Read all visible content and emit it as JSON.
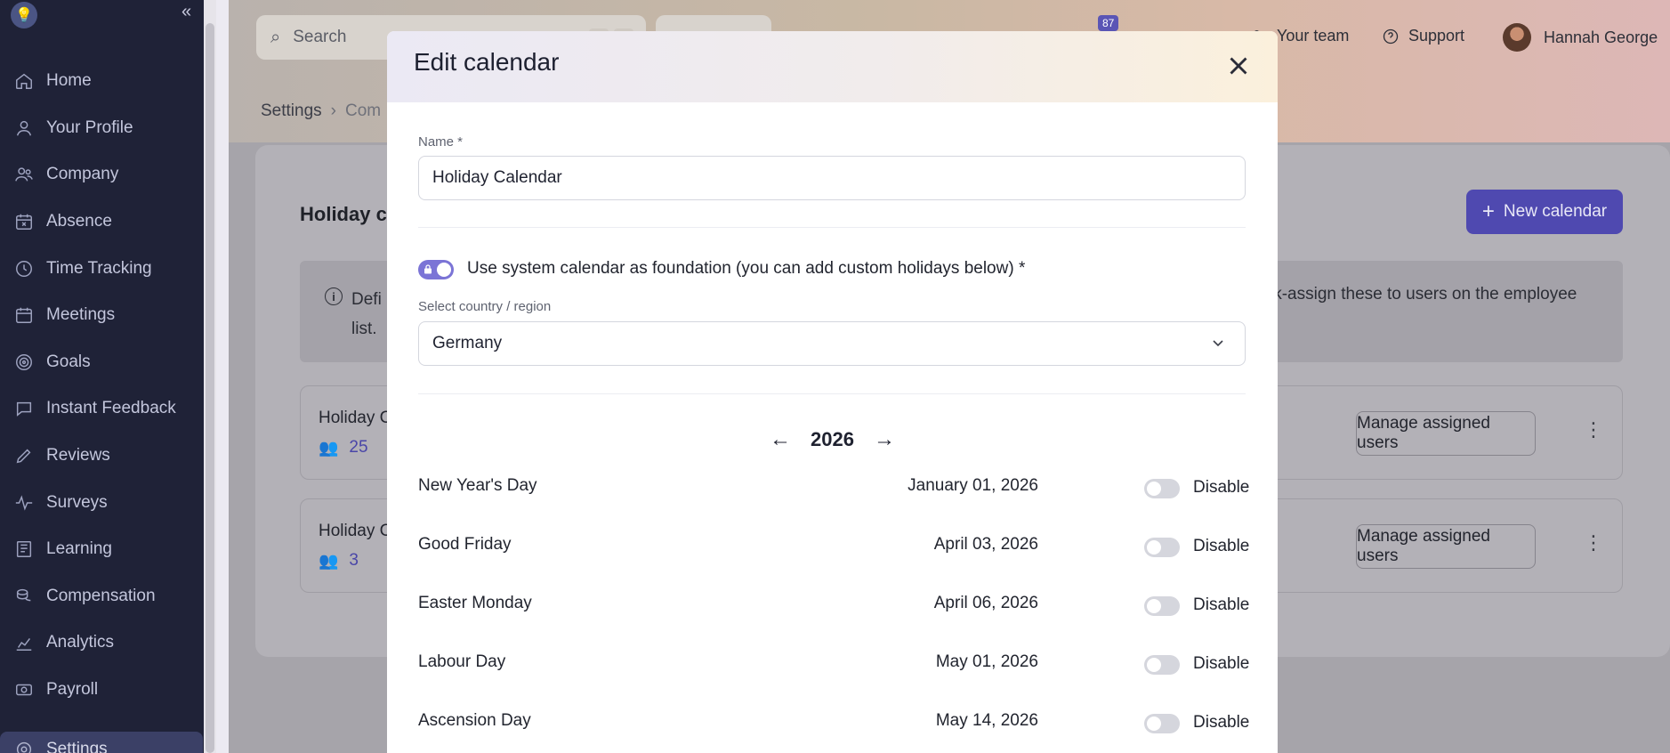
{
  "sidebar": {
    "collapse_glyph": "«",
    "items": [
      {
        "label": "Home",
        "icon": "home-icon"
      },
      {
        "label": "Your Profile",
        "icon": "user-icon"
      },
      {
        "label": "Company",
        "icon": "users-icon"
      },
      {
        "label": "Absence",
        "icon": "calendar-x-icon"
      },
      {
        "label": "Time Tracking",
        "icon": "clock-icon"
      },
      {
        "label": "Meetings",
        "icon": "calendar-icon"
      },
      {
        "label": "Goals",
        "icon": "target-icon"
      },
      {
        "label": "Instant Feedback",
        "icon": "chat-icon"
      },
      {
        "label": "Reviews",
        "icon": "pencil-icon"
      },
      {
        "label": "Surveys",
        "icon": "pulse-icon"
      },
      {
        "label": "Learning",
        "icon": "book-icon"
      },
      {
        "label": "Compensation",
        "icon": "coins-icon"
      },
      {
        "label": "Analytics",
        "icon": "chart-icon"
      },
      {
        "label": "Payroll",
        "icon": "cash-icon"
      }
    ],
    "settings_label": "Settings"
  },
  "topbar": {
    "search_placeholder": "Search",
    "notifications_count": "87",
    "team_label": "Your team",
    "support_label": "Support",
    "user_name": "Hannah George"
  },
  "breadcrumb": {
    "root": "Settings",
    "current": "Com"
  },
  "page": {
    "title": "Holiday ca",
    "new_calendar_label": "New calendar",
    "info_left_line1": "Defi",
    "info_left_line2": "list.",
    "info_right": "lk-assign these to users on the employee",
    "rows": [
      {
        "name": "Holiday C",
        "count": "25",
        "manage_label": "Manage assigned users"
      },
      {
        "name": "Holiday C",
        "count": "3",
        "manage_label": "Manage assigned users"
      }
    ]
  },
  "modal": {
    "title": "Edit calendar",
    "name_label": "Name *",
    "name_value": "Holiday Calendar",
    "system_calendar_label": "Use system calendar as foundation (you can add custom holidays below) *",
    "country_label": "Select country / region",
    "country_value": "Germany",
    "year": "2026",
    "prev_arrow": "←",
    "next_arrow": "→",
    "holidays": [
      {
        "name": "New Year's Day",
        "date": "January 01, 2026",
        "action": "Disable"
      },
      {
        "name": "Good Friday",
        "date": "April 03, 2026",
        "action": "Disable"
      },
      {
        "name": "Easter Monday",
        "date": "April 06, 2026",
        "action": "Disable"
      },
      {
        "name": "Labour Day",
        "date": "May 01, 2026",
        "action": "Disable"
      },
      {
        "name": "Ascension Day",
        "date": "May 14, 2026",
        "action": "Disable"
      }
    ]
  },
  "colors": {
    "sidebar_bg": "#1f2237",
    "accent": "#4f49b0",
    "toggle_on": "#7b74d6"
  }
}
